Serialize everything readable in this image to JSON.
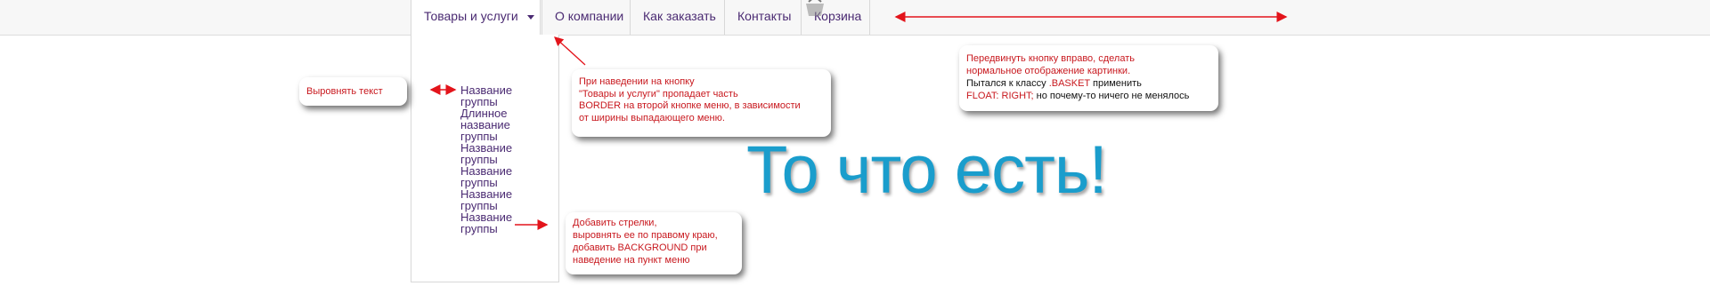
{
  "nav": {
    "items": [
      {
        "label": "Товары и услуги"
      },
      {
        "label": "О компании"
      },
      {
        "label": "Как заказать"
      },
      {
        "label": "Контакты"
      },
      {
        "label": "Корзина"
      }
    ]
  },
  "dropdown": {
    "items": [
      {
        "label": "Название группы"
      },
      {
        "label": "Длинное название группы"
      },
      {
        "label": "Название группы"
      },
      {
        "label": "Название группы"
      },
      {
        "label": "Название группы"
      },
      {
        "label": "Название группы"
      }
    ]
  },
  "notes": {
    "align_text": "Выровнять текст",
    "hover": {
      "l1": "При наведении на кнопку",
      "l2": "\"Товары и услуги\" пропадает часть",
      "l3": "BORDER на второй кнопке меню, в зависимости",
      "l4": "от ширины выпадающего меню."
    },
    "arrows": {
      "l1": "Добавить стрелки,",
      "l2": "выровнять ее по правому краю,",
      "l3": "добавить BACKGROUND при",
      "l4": "наведение на пункт меню"
    },
    "basket": {
      "l1": "Передвинуть кнопку вправо, сделать",
      "l2": "нормальное отображение картинки.",
      "l3a": "Пытался к классу ",
      "l3b": ".BASKET",
      "l3c": " применить",
      "l4a": "FLOAT: RIGHT;",
      "l4b": " но почему-то ничего не менялось"
    }
  },
  "big_title": "То что есть!",
  "colors": {
    "nav_text": "#4a2a72",
    "note_red": "#c8181e",
    "title_blue": "#1a9dcc"
  }
}
